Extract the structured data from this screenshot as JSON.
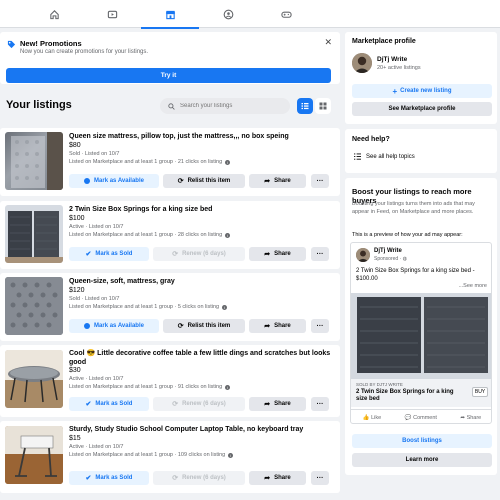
{
  "nav": {
    "tabs": [
      {
        "icon": "home-icon"
      },
      {
        "icon": "video-icon"
      },
      {
        "icon": "marketplace-icon",
        "active": true
      },
      {
        "icon": "groups-icon"
      },
      {
        "icon": "gaming-icon"
      }
    ]
  },
  "promo": {
    "title": "New! Promotions",
    "subtitle": "Now you can create promotions for your listings.",
    "close": "✕",
    "cta": "Try it"
  },
  "listings_header": {
    "title": "Your listings",
    "search_placeholder": "Search your listings"
  },
  "listings": [
    {
      "title": "Queen size mattress, pillow top, just the mattress,,, no box speing",
      "price": "$80",
      "status": "Sold · Listed on 10/7",
      "info": "Listed on Marketplace and at least 1 group · 21 clicks on listing",
      "primary": "Mark as Available",
      "secondary": "Relist this item",
      "share": "Share",
      "more": "···"
    },
    {
      "title": "2 Twin Size Box Springs for a king size bed",
      "price": "$100",
      "status": "Active · Listed on 10/7",
      "info": "Listed on Marketplace and at least 1 group · 28 clicks on listing",
      "primary": "Mark as Sold",
      "secondary": "Renew (6 days)",
      "share": "Share",
      "more": "···"
    },
    {
      "title": "Queen-size, soft, mattress, gray",
      "price": "$120",
      "status": "Sold · Listed on 10/7",
      "info": "Listed on Marketplace and at least 1 group · 5 clicks on listing",
      "primary": "Mark as Available",
      "secondary": "Relist this item",
      "share": "Share",
      "more": "···"
    },
    {
      "title": "Cool 😎 Little decorative coffee table a few little dings and scratches but looks good",
      "price": "$30",
      "status": "Active · Listed on 10/7",
      "info": "Listed on Marketplace and at least 1 group · 91 clicks on listing",
      "primary": "Mark as Sold",
      "secondary": "Renew (6 days)",
      "share": "Share",
      "more": "···"
    },
    {
      "title": "Sturdy, Study Studio School Computer Laptop Table, no keyboard tray",
      "price": "$15",
      "status": "Active · Listed on 10/7",
      "info": "Listed on Marketplace and at least 1 group · 109 clicks on listing",
      "primary": "Mark as Sold",
      "secondary": "Renew (6 days)",
      "share": "Share",
      "more": "···"
    }
  ],
  "profile": {
    "heading": "Marketplace profile",
    "name": "DjTj Write",
    "active": "20+ active listings",
    "create": "Create new listing",
    "see": "See Marketplace profile"
  },
  "help": {
    "heading": "Need help?",
    "topics": "See all help topics"
  },
  "boost": {
    "heading": "Boost your listings to reach more buyers",
    "desc": "Boosting your listings turns them into ads that may appear in Feed, on Marketplace and more places.",
    "preview_label": "This is a preview of how your ad may appear:",
    "ad_name": "DjTj Write",
    "ad_sponsored": "Sponsored · ",
    "ad_text": "2 Twin Size Box Springs for a king size bed - $100.00",
    "see_more": "...See more",
    "sold_by": "SOLD BY DJTJ WRITE",
    "ad_caption": "2 Twin Size Box Springs for a king size bed",
    "buy": "BUY",
    "like": "Like",
    "comment": "Comment",
    "share": "Share",
    "boost_btn": "Boost listings",
    "learn_btn": "Learn more"
  },
  "colors": {
    "accent": "#1877f2",
    "background": "#f0f2f5"
  }
}
